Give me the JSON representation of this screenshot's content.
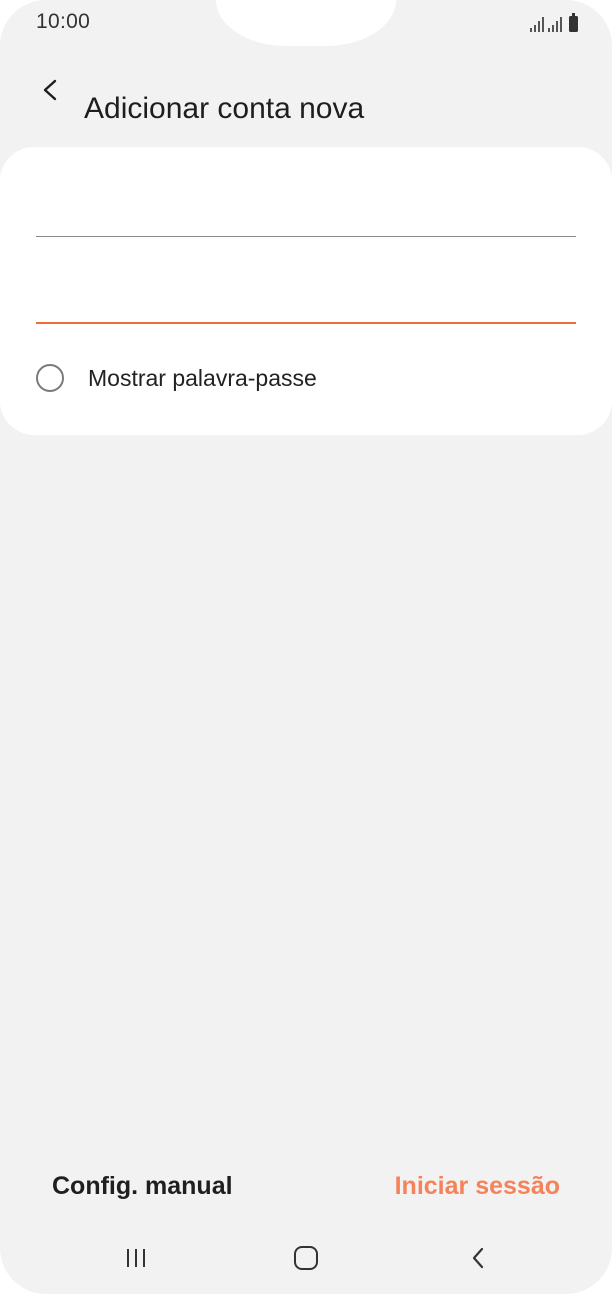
{
  "status_bar": {
    "time": "10:00",
    "signal_icon": "signal-icon",
    "battery_icon": "battery-icon"
  },
  "header": {
    "back_icon": "chevron-left-icon",
    "title": "Adicionar conta nova"
  },
  "form": {
    "email": {
      "value": "",
      "placeholder": ""
    },
    "password": {
      "value": "",
      "placeholder": ""
    },
    "show_password": {
      "label": "Mostrar palavra-passe",
      "checked": false
    }
  },
  "actions": {
    "manual_label": "Config. manual",
    "login_label": "Iniciar sessão"
  },
  "navigation": {
    "recent_icon": "recent-apps-icon",
    "home_icon": "home-icon",
    "back_icon": "back-icon"
  },
  "colors": {
    "accent": "#f26b3a",
    "login_text": "#f5835a",
    "background": "#f2f2f2",
    "card": "#ffffff"
  }
}
